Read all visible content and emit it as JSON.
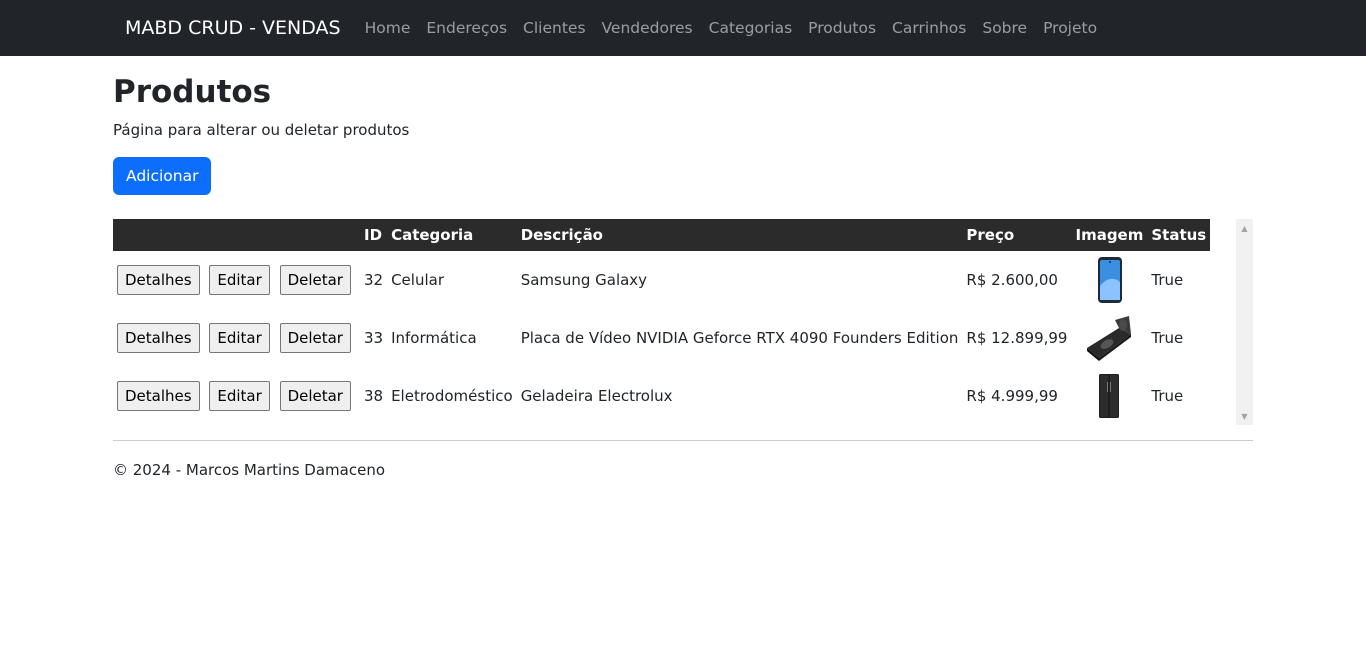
{
  "nav": {
    "brand": "MABD CRUD - VENDAS",
    "links": [
      "Home",
      "Endereços",
      "Clientes",
      "Vendedores",
      "Categorias",
      "Produtos",
      "Carrinhos",
      "Sobre",
      "Projeto"
    ]
  },
  "page": {
    "title": "Produtos",
    "subtitle": "Página para alterar ou deletar produtos",
    "add_label": "Adicionar"
  },
  "table": {
    "headers": {
      "id": "ID",
      "categoria": "Categoria",
      "descricao": "Descrição",
      "preco": "Preço",
      "imagem": "Imagem",
      "status": "Status"
    },
    "actions": {
      "details": "Detalhes",
      "edit": "Editar",
      "delete": "Deletar"
    },
    "rows": [
      {
        "id": "32",
        "categoria": "Celular",
        "descricao": "Samsung Galaxy",
        "preco": "R$ 2.600,00",
        "image_icon": "phone-icon",
        "status": "True"
      },
      {
        "id": "33",
        "categoria": "Informática",
        "descricao": "Placa de Vídeo NVIDIA Geforce RTX 4090 Founders Edition",
        "preco": "R$ 12.899,99",
        "image_icon": "gpu-icon",
        "status": "True"
      },
      {
        "id": "38",
        "categoria": "Eletrodoméstico",
        "descricao": "Geladeira Electrolux",
        "preco": "R$ 4.999,99",
        "image_icon": "fridge-icon",
        "status": "True"
      }
    ]
  },
  "footer": {
    "text": "© 2024 - Marcos Martins Damaceno"
  },
  "colors": {
    "navbar": "#212529",
    "primary": "#0d6efd",
    "table_header": "#2b2b2b"
  }
}
